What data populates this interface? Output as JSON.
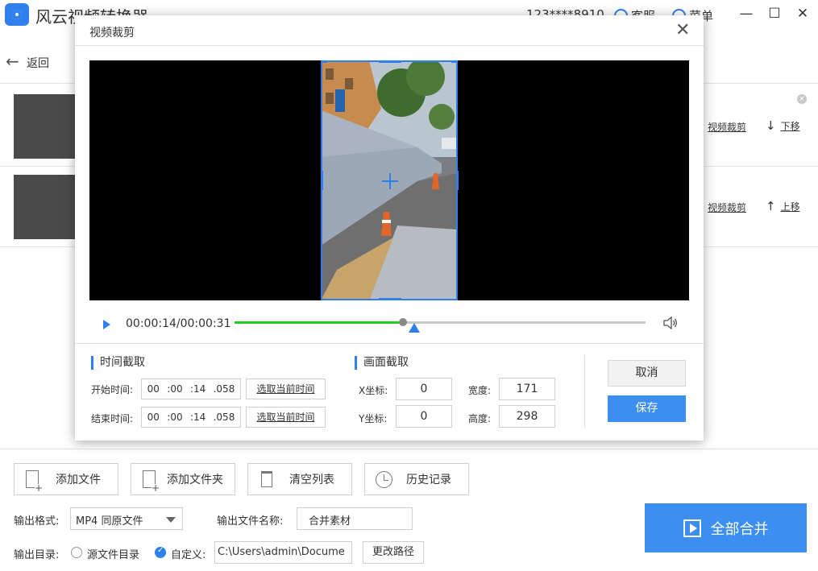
{
  "app": {
    "title": "风云视频转换器",
    "account": "123****8910",
    "service": "客服",
    "menu": "菜单"
  },
  "nav": {
    "back": "返回"
  },
  "file_rows": [
    {
      "clip_link": "视频裁剪",
      "move_arrow": "↓",
      "move_label": "下移"
    },
    {
      "clip_link": "视频裁剪",
      "move_arrow": "↑",
      "move_label": "上移"
    }
  ],
  "actions": {
    "add_file": "添加文件",
    "add_folder": "添加文件夹",
    "clear_list": "清空列表",
    "history": "历史记录"
  },
  "output": {
    "format_label": "输出格式:",
    "format_value": "MP4 同原文件",
    "name_label": "输出文件名称:",
    "name_value": "合并素材",
    "dir_label": "输出目录:",
    "dir_option_source": "源文件目录",
    "dir_option_custom": "自定义:",
    "dir_value": "C:\\Users\\admin\\Docume",
    "change_path": "更改路径"
  },
  "merge_button": "全部合并",
  "dialog": {
    "title": "视频裁剪",
    "time_display": "00:00:14/00:00:31",
    "progress_fraction": 0.41,
    "time_section": "时间截取",
    "start_label": "开始时间:",
    "end_label": "结束时间:",
    "start_time": {
      "h": "00",
      "m": ":00",
      "s": ":14",
      "ms": ".058"
    },
    "end_time": {
      "h": "00",
      "m": ":00",
      "s": ":14",
      "ms": ".058"
    },
    "pick_current": "选取当前时间",
    "frame_section": "画面截取",
    "x_label": "X坐标:",
    "y_label": "Y坐标:",
    "width_label": "宽度:",
    "height_label": "高度:",
    "x_value": "0",
    "y_value": "0",
    "width_value": "171",
    "height_value": "298",
    "cancel": "取消",
    "save": "保存"
  },
  "colors": {
    "accent": "#2f80ed",
    "progress": "#22cc22",
    "primary_button": "#3c8ff0"
  }
}
